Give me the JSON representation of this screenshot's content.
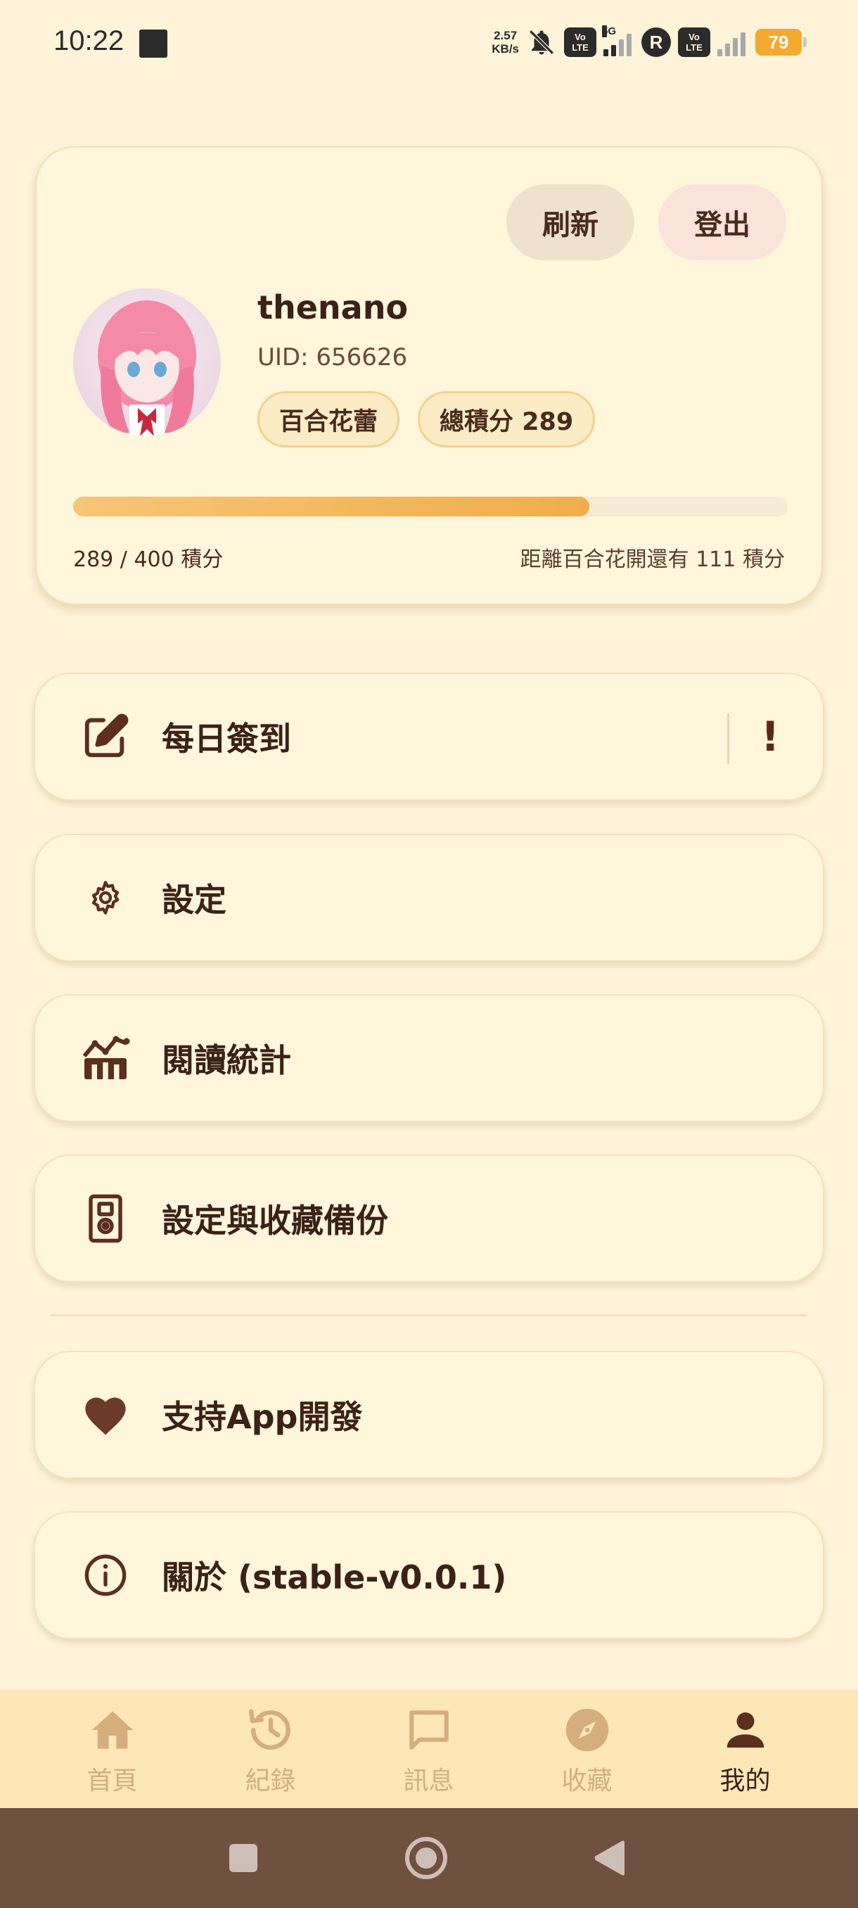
{
  "status_bar": {
    "time": "10:22",
    "net_speed_value": "2.57",
    "net_speed_unit": "KB/s",
    "volte_1": "Vo\nLTE",
    "network_type": "5G",
    "volte_2": "Vo\nLTE",
    "roaming": "R",
    "battery": "79",
    "icons": [
      "notification-square-icon",
      "bell-muted-icon",
      "volte-icon",
      "signal-5g-icon",
      "roaming-icon",
      "volte-icon",
      "signal-icon",
      "battery-icon"
    ]
  },
  "profile": {
    "refresh_label": "刷新",
    "logout_label": "登出",
    "username": "thenano",
    "uid": "UID: 656626",
    "rank_badge": "百合花蕾",
    "points_badge": "總積分 289",
    "progress_fraction": 0.7225,
    "progress_text": "289 / 400 積分",
    "progress_remaining": "距離百合花開還有 111 積分"
  },
  "menu": {
    "items": [
      {
        "label": "每日簽到",
        "icon": "edit-icon",
        "alert": "!"
      },
      {
        "label": "設定",
        "icon": "gear-icon"
      },
      {
        "label": "閱讀統計",
        "icon": "stats-chart-icon"
      },
      {
        "label": "設定與收藏備份",
        "icon": "backup-device-icon"
      },
      {
        "label": "支持App開發",
        "icon": "heart-icon"
      },
      {
        "label": "關於 (stable-v0.0.1)",
        "icon": "info-icon"
      }
    ]
  },
  "bottom_nav": {
    "items": [
      {
        "label": "首頁",
        "icon": "home-icon"
      },
      {
        "label": "紀錄",
        "icon": "history-icon"
      },
      {
        "label": "訊息",
        "icon": "message-icon"
      },
      {
        "label": "收藏",
        "icon": "compass-icon"
      },
      {
        "label": "我的",
        "icon": "person-icon",
        "active": true
      }
    ]
  },
  "system_nav": {
    "buttons": [
      "recents-square-icon",
      "home-circle-icon",
      "back-triangle-icon"
    ]
  },
  "colors": {
    "background": "#fff3d9",
    "card": "#fff6dc",
    "accent": "#f1ad4b",
    "text_dark": "#3b2116",
    "nav_inactive": "#d5ae7e",
    "system_bar": "#6f5140"
  }
}
